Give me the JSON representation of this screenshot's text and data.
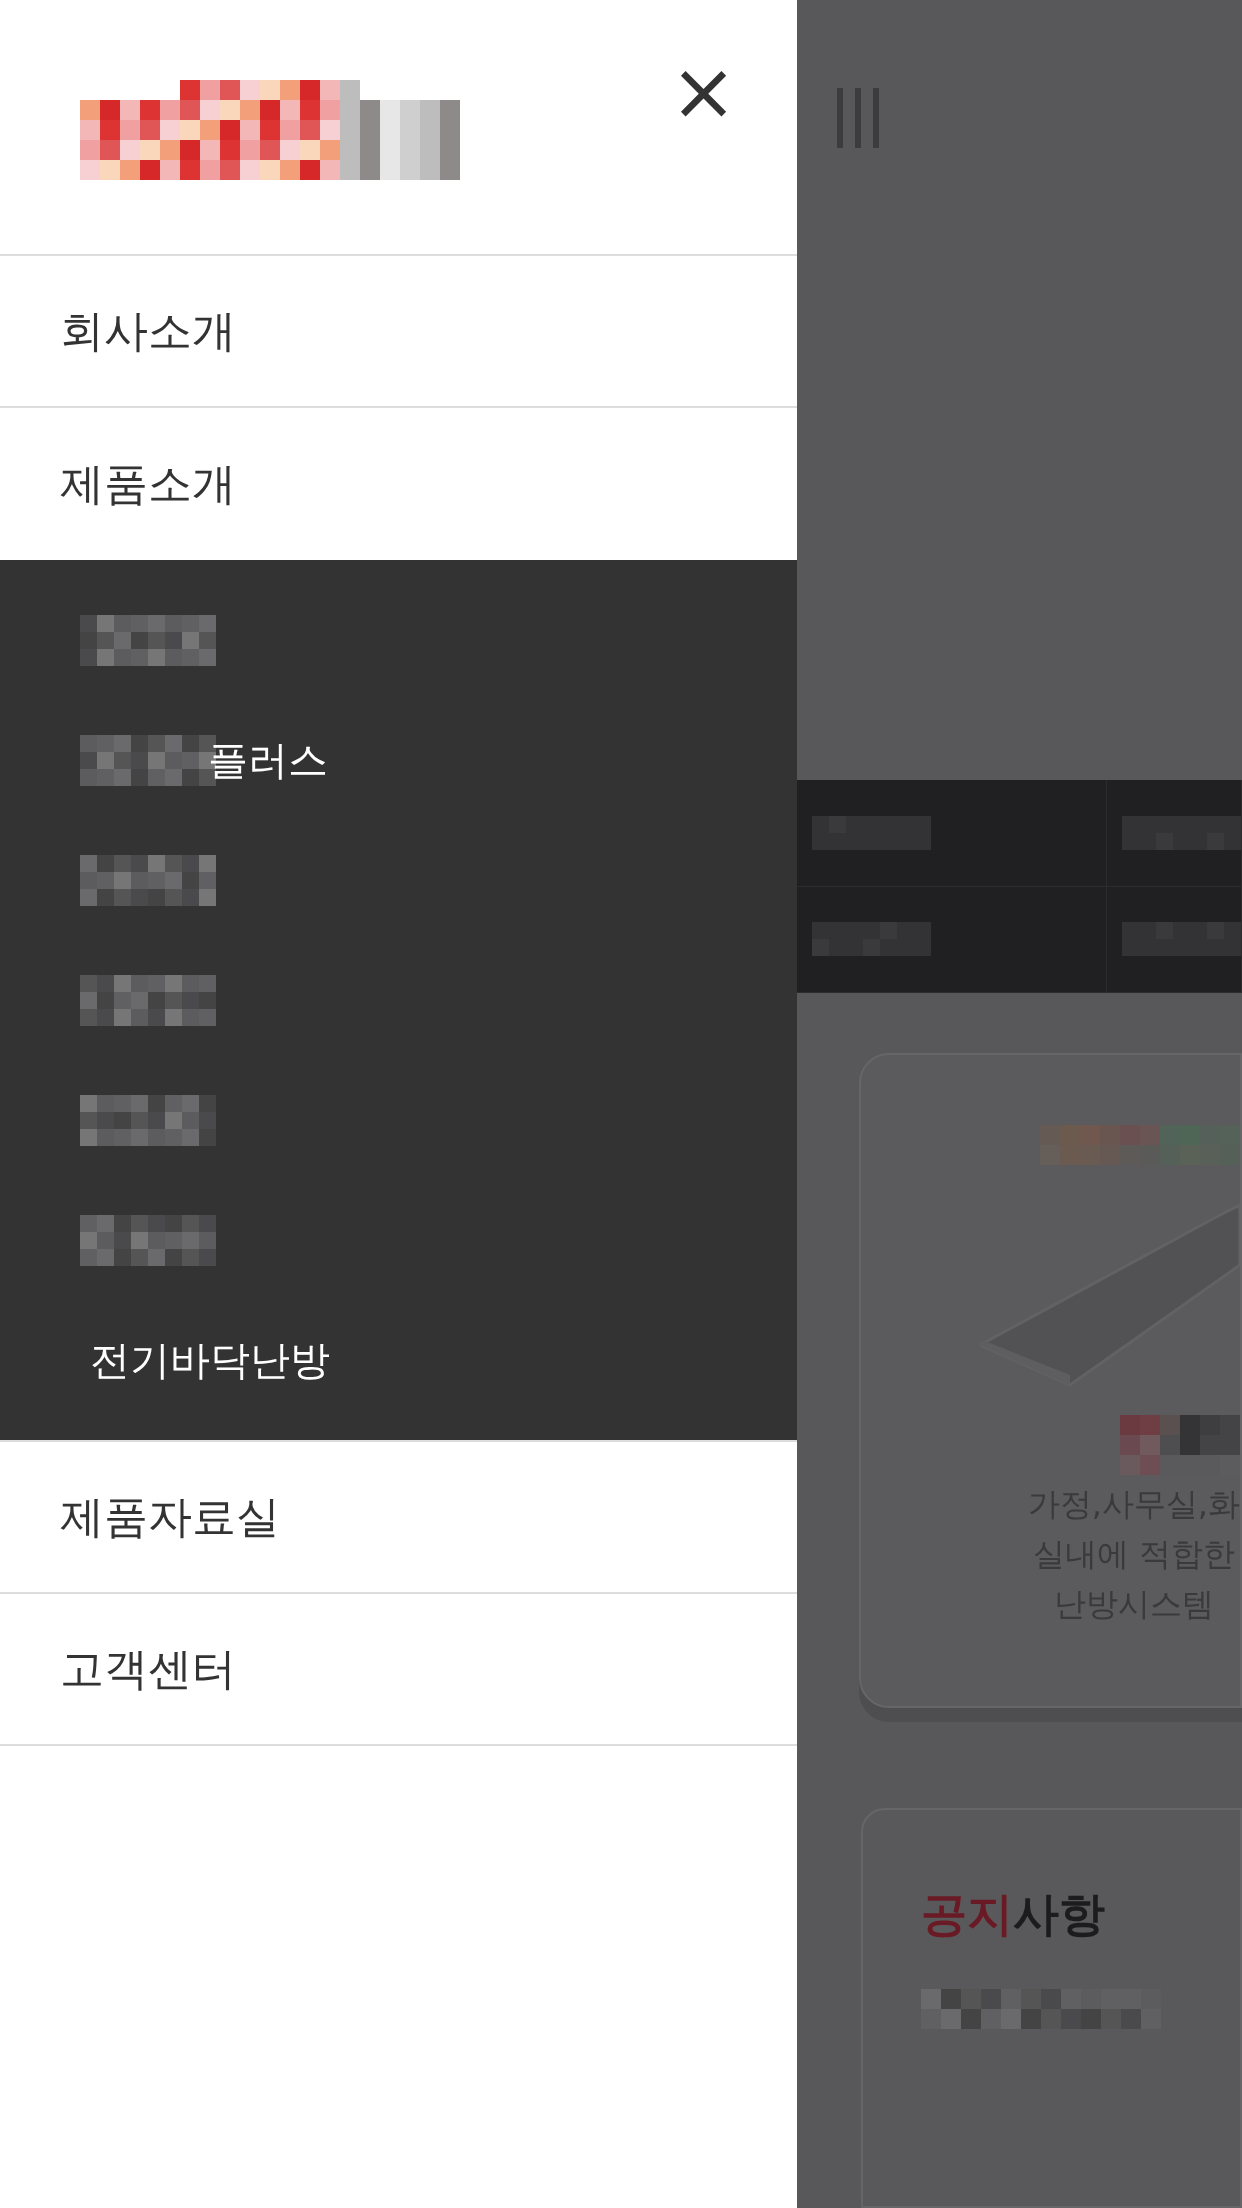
{
  "drawer": {
    "close_label": "×",
    "menu": [
      {
        "label": "회사소개",
        "expanded": false
      },
      {
        "label": "제품소개",
        "expanded": true,
        "children": [
          {
            "kind": "redacted"
          },
          {
            "kind": "redacted_prefix",
            "label": "플러스"
          },
          {
            "kind": "redacted"
          },
          {
            "kind": "redacted"
          },
          {
            "kind": "redacted"
          },
          {
            "kind": "redacted"
          },
          {
            "kind": "text",
            "label": "전기바닥난방"
          }
        ]
      },
      {
        "label": "제품자료실",
        "expanded": false
      },
      {
        "label": "고객센터",
        "expanded": false
      }
    ]
  },
  "page": {
    "product_card": {
      "description": [
        "가정,사무실,화",
        "실내에 적합한",
        "난방시스템"
      ]
    },
    "notice": {
      "title": "**공지**사항"
    }
  }
}
